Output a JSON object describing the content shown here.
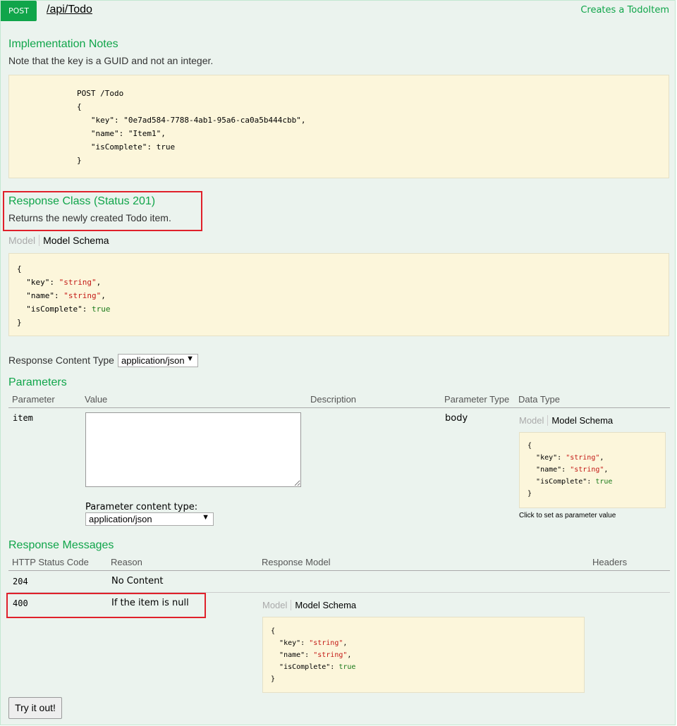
{
  "operation": {
    "method": "POST",
    "path": "/api/Todo",
    "summary": "Creates a TodoItem"
  },
  "implementation_notes": {
    "title": "Implementation Notes",
    "text": "Note that the key is a GUID and not an integer.",
    "code_lines": [
      "POST /Todo",
      "{",
      "   \"key\": \"0e7ad584-7788-4ab1-95a6-ca0a5b444cbb\",",
      "   \"name\": \"Item1\",",
      "   \"isComplete\": true",
      "}"
    ]
  },
  "response_class": {
    "title": "Response Class (Status 201)",
    "text": "Returns the newly created Todo item.",
    "tab_model": "Model",
    "tab_schema": "Model Schema",
    "schema": {
      "open": "{",
      "fields": [
        {
          "key": "\"key\"",
          "value": "\"string\"",
          "kind": "string"
        },
        {
          "key": "\"name\"",
          "value": "\"string\"",
          "kind": "string"
        },
        {
          "key": "\"isComplete\"",
          "value": "true",
          "kind": "bool"
        }
      ],
      "close": "}"
    }
  },
  "response_content_type": {
    "label": "Response Content Type",
    "value": "application/json"
  },
  "parameters": {
    "title": "Parameters",
    "headers": [
      "Parameter",
      "Value",
      "Description",
      "Parameter Type",
      "Data Type"
    ],
    "row": {
      "name": "item",
      "param_type": "body",
      "content_type_label": "Parameter content type:",
      "content_type_value": "application/json",
      "tab_model": "Model",
      "tab_schema": "Model Schema",
      "hint": "Click to set as parameter value"
    }
  },
  "response_messages": {
    "title": "Response Messages",
    "headers": [
      "HTTP Status Code",
      "Reason",
      "Response Model",
      "Headers"
    ],
    "rows": [
      {
        "code": "204",
        "reason": "No Content"
      },
      {
        "code": "400",
        "reason": "If the item is null",
        "tab_model": "Model",
        "tab_schema": "Model Schema"
      }
    ]
  },
  "try_button": "Try it out!",
  "colors": {
    "accent": "#10a54a",
    "panel_bg": "#ebf3ee",
    "code_bg": "#fcf6db",
    "highlight": "#e0202a"
  }
}
